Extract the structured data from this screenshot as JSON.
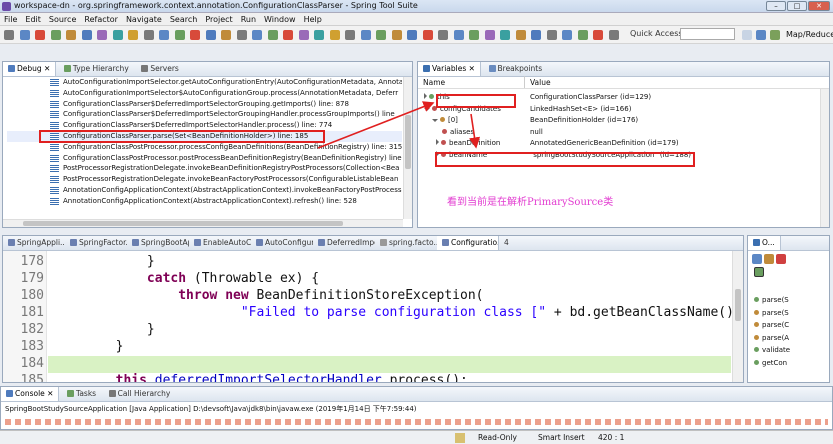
{
  "window": {
    "title": "workspace-dn - org.springframework.context.annotation.ConfigurationClassParser - Spring Tool Suite"
  },
  "menu": [
    "File",
    "Edit",
    "Source",
    "Refactor",
    "Navigate",
    "Search",
    "Project",
    "Run",
    "Window",
    "Help"
  ],
  "toolbar": {
    "quick_access": "Quick Access",
    "perspective": "Map/Reduce"
  },
  "debug_view": {
    "tabs": [
      "Debug",
      "Type Hierarchy",
      "Servers"
    ],
    "frames": [
      "AutoConfigurationImportSelector.getAutoConfigurationEntry(AutoConfigurationMetadata, Annota",
      "AutoConfigurationImportSelector$AutoConfigurationGroup.process(AnnotationMetadata, Deferr",
      "ConfigurationClassParser$DeferredImportSelectorGrouping.getImports() line: 878",
      "ConfigurationClassParser$DeferredImportSelectorGroupingHandler.processGroupImports() line",
      "ConfigurationClassParser$DeferredImportSelectorHandler.process() line: 774",
      "ConfigurationClassParser.parse(Set<BeanDefinitionHolder>) line: 185",
      "ConfigurationClassPostProcessor.processConfigBeanDefinitions(BeanDefinitionRegistry) line: 315",
      "ConfigurationClassPostProcessor.postProcessBeanDefinitionRegistry(BeanDefinitionRegistry) line",
      "PostProcessorRegistrationDelegate.invokeBeanDefinitionRegistryPostProcessors(Collection<Bea",
      "PostProcessorRegistrationDelegate.invokeBeanFactoryPostProcessors(ConfigurableListableBean",
      "AnnotationConfigApplicationContext(AbstractApplicationContext).invokeBeanFactoryPostProcess",
      "AnnotationConfigApplicationContext(AbstractApplicationContext).refresh() line: 528"
    ]
  },
  "variables_view": {
    "tabs": [
      "Variables",
      "Breakpoints"
    ],
    "columns": {
      "name": "Name",
      "value": "Value"
    },
    "rows": [
      {
        "name": "this",
        "value": "ConfigurationClassParser  (id=129)"
      },
      {
        "name": "configCandidates",
        "value": "LinkedHashSet<E>  (id=166)"
      },
      {
        "name": "[0]",
        "value": "BeanDefinitionHolder  (id=176)"
      },
      {
        "name": "aliases",
        "value": "null"
      },
      {
        "name": "beanDefinition",
        "value": "AnnotatedGenericBeanDefinition  (id=179)"
      },
      {
        "name": "beanName",
        "value": "\"springBootStudySourceApplication\" (id=188)"
      }
    ],
    "annotation": "看到当前是在解析PrimarySource类"
  },
  "editor": {
    "tabs": [
      "SpringAppli...",
      "SpringFactor...",
      "SpringBootAp...",
      "EnableAutoCo...",
      "AutoConfigur...",
      "DeferredImpo...",
      "spring.facto...",
      "Configuratio...",
      "4"
    ],
    "lines": [
      {
        "num": "178",
        "text": "            }"
      },
      {
        "num": "179",
        "text": "            catch (Throwable ex) {"
      },
      {
        "num": "180",
        "text": "                throw new BeanDefinitionStoreException("
      },
      {
        "num": "181",
        "text": "                        \"Failed to parse configuration class [\" + bd.getBeanClassName() + \"]"
      },
      {
        "num": "182",
        "text": "            }"
      },
      {
        "num": "183",
        "text": "        }"
      },
      {
        "num": "184",
        "text": ""
      },
      {
        "num": "185",
        "text": "        this.deferredImportSelectorHandler.process();"
      }
    ]
  },
  "outline_view": {
    "tab": "O...",
    "items": [
      "parse(S",
      "parse(S",
      "parse(C",
      "parse(A",
      "validate",
      "getCon"
    ]
  },
  "console_view": {
    "tabs": [
      "Console",
      "Tasks",
      "Call Hierarchy"
    ],
    "launch": "SpringBootStudySourceApplication [Java Application] D:\\devsoft\\Java\\jdk8\\bin\\javaw.exe (2019年1月14日 下午7:59:44)"
  },
  "status_bar": {
    "mode": "Read-Only",
    "insert": "Smart Insert",
    "position": "420 : 1"
  },
  "colors": {
    "accent": "#3b6fb0",
    "annotation": "#e23bd0",
    "highlight_box": "#e02020",
    "current_line": "#d9f2c4"
  }
}
